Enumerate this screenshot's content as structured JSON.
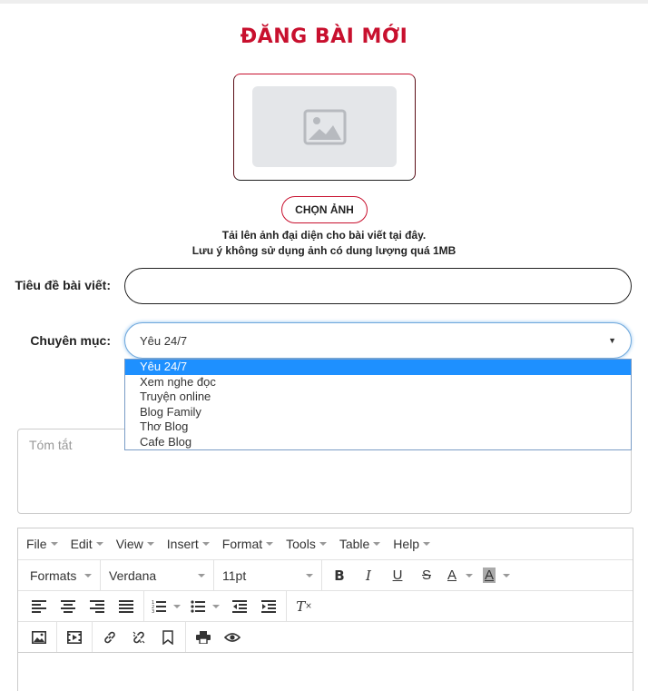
{
  "page": {
    "title": "ĐĂNG BÀI MỚI",
    "choose_image_label": "CHỌN ẢNH",
    "hint_line1": "Tải lên ảnh đại diện cho bài viết tại đây.",
    "hint_line2": "Lưu ý không sử dụng ảnh có dung lượng quá 1MB"
  },
  "form": {
    "title_label": "Tiêu đề bài viết:",
    "title_value": "",
    "category_label": "Chuyên mục:",
    "category_selected": "Yêu 24/7",
    "category_options": [
      "Yêu 24/7",
      "Xem nghe đọc",
      "Truyện online",
      "Blog Family",
      "Thơ Blog",
      "Cafe Blog"
    ],
    "summary_placeholder": "Tóm tắt"
  },
  "editor": {
    "menus": [
      "File",
      "Edit",
      "View",
      "Insert",
      "Format",
      "Tools",
      "Table",
      "Help"
    ],
    "formats_label": "Formats",
    "font_family": "Verdana",
    "font_size": "11pt"
  },
  "colors": {
    "brand_red": "#c8102e",
    "select_highlight": "#1e90ff"
  }
}
